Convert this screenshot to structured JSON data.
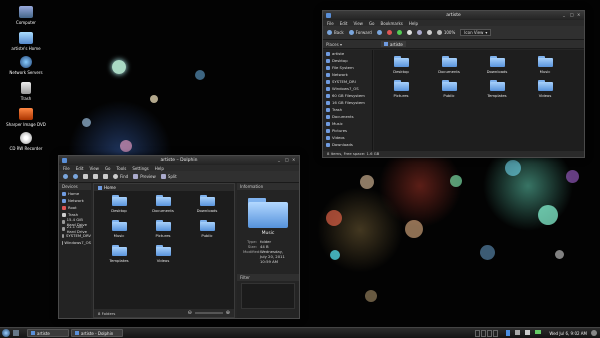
{
  "desktop_icons": [
    {
      "label": "Computer"
    },
    {
      "label": "artiste's Home"
    },
    {
      "label": "Network Servers"
    },
    {
      "label": "Trash"
    },
    {
      "label": "Sharper Image DVD"
    },
    {
      "label": "CD RW Recorder"
    }
  ],
  "nautilus": {
    "title": "artiste",
    "menu": [
      "File",
      "Edit",
      "View",
      "Go",
      "Bookmarks",
      "Help"
    ],
    "toolbar": {
      "back": "Back",
      "forward": "Forward",
      "zoom": "100%",
      "view_mode": "Icon View"
    },
    "places_label": "Places",
    "breadcrumb": "artiste",
    "places": [
      "artiste",
      "Desktop",
      "File System",
      "Network",
      "SYSTEM_DRI",
      "Windows7_OS",
      "60 GB Filesystem",
      "16 GB Filesystem",
      "Trash",
      "Documents",
      "Music",
      "Pictures",
      "Videos",
      "Downloads"
    ],
    "files": [
      "Desktop",
      "Documents",
      "Downloads",
      "Music",
      "Pictures",
      "Public",
      "Templates",
      "Videos"
    ],
    "status": "8 items, Free space: 1.6 GB"
  },
  "dolphin": {
    "title": "artiste – Dolphin",
    "menu": [
      "File",
      "Edit",
      "View",
      "Go",
      "Tools",
      "Settings",
      "Help"
    ],
    "toolbar": {
      "find": "Find",
      "preview": "Preview",
      "split": "Split"
    },
    "places_label": "Devices",
    "places": [
      "Home",
      "Network",
      "Root",
      "Trash",
      "15.4 GiB Hard Drive",
      "21.1 GiB Hard Drive",
      "SYSTEM_DRV",
      "Windows7_OS"
    ],
    "breadcrumb": "Home",
    "files": [
      "Desktop",
      "Documents",
      "Downloads",
      "Music",
      "Pictures",
      "Public",
      "Templates",
      "Videos"
    ],
    "info_label": "Information",
    "info": {
      "name": "Music",
      "type_label": "Type:",
      "type_value": "folder",
      "size_label": "Size:",
      "size_value": "44 B",
      "modified_label": "Modified:",
      "modified_value": "Wednesday, July 20, 2011 10:59 AM"
    },
    "filter_label": "Filter",
    "status": "8 Folders"
  },
  "taskbar": {
    "tasks": [
      "artiste",
      "artiste - Dolphin"
    ],
    "clock": "Wed Jul 6, 9:02 AM"
  }
}
